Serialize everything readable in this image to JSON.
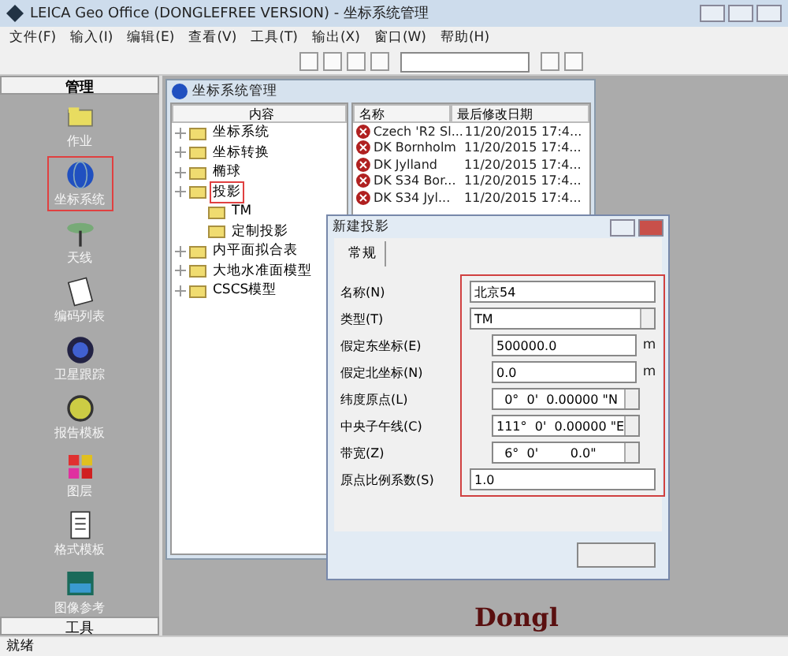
{
  "window": {
    "title": "LEICA Geo Office (DONGLEFREE VERSION) - 坐标系统管理"
  },
  "menu": [
    "文件(F)",
    "输入(I)",
    "编辑(E)",
    "查看(V)",
    "工具(T)",
    "输出(X)",
    "窗口(W)",
    "帮助(H)"
  ],
  "sidebar": {
    "header": "管理",
    "footer": "工具",
    "items": [
      {
        "label": "作业",
        "selected": false
      },
      {
        "label": "坐标系统",
        "selected": true
      },
      {
        "label": "天线",
        "selected": false
      },
      {
        "label": "编码列表",
        "selected": false
      },
      {
        "label": "卫星跟踪",
        "selected": false
      },
      {
        "label": "报告模板",
        "selected": false
      },
      {
        "label": "图层",
        "selected": false
      },
      {
        "label": "格式模板",
        "selected": false
      },
      {
        "label": "图像参考",
        "selected": false
      }
    ]
  },
  "child_window": {
    "title": "坐标系统管理",
    "tree_header": "内容",
    "tree": [
      {
        "label": "坐标系统",
        "selected": false
      },
      {
        "label": "坐标转换",
        "selected": false
      },
      {
        "label": "椭球",
        "selected": false
      },
      {
        "label": "投影",
        "selected": true,
        "children": [
          {
            "label": "TM",
            "selected": false
          },
          {
            "label": "定制投影",
            "selected": false
          }
        ]
      },
      {
        "label": "内平面拟合表",
        "selected": false
      },
      {
        "label": "大地水准面模型",
        "selected": false
      },
      {
        "label": "CSCS模型",
        "selected": false
      }
    ],
    "columns": [
      "名称",
      "最后修改日期"
    ],
    "rows": [
      [
        "Czech 'R2 Sl...",
        "11/20/2015 17:4..."
      ],
      [
        "DK Bornholm",
        "11/20/2015 17:4..."
      ],
      [
        "DK Jylland",
        "11/20/2015 17:4..."
      ],
      [
        "DK S34 Bor...",
        "11/20/2015 17:4..."
      ],
      [
        "DK S34 Jyl...",
        "11/20/2015 17:4..."
      ]
    ]
  },
  "dialog": {
    "title": "新建投影",
    "tab": "常规",
    "fields": [
      {
        "label": "名称(N)",
        "value": "北京54",
        "kind": "text"
      },
      {
        "label": "类型(T)",
        "value": "TM",
        "kind": "dropdown"
      },
      {
        "label": "假定东坐标(E)",
        "value": "500000.0",
        "kind": "unit",
        "unit": "m"
      },
      {
        "label": "假定北坐标(N)",
        "value": "0.0",
        "kind": "unit",
        "unit": "m"
      },
      {
        "label": "纬度原点(L)",
        "value": "  0°  0'  0.00000 \"N",
        "kind": "spin"
      },
      {
        "label": "中央子午线(C)",
        "value": "111°  0'  0.00000 \"E",
        "kind": "spin"
      },
      {
        "label": "带宽(Z)",
        "value": "  6°  0'        0.0\"",
        "kind": "spin"
      },
      {
        "label": "原点比例系数(S)",
        "value": "1.0",
        "kind": "text"
      }
    ]
  },
  "backdrop_text": "Dongl",
  "status_bar": "就绪"
}
